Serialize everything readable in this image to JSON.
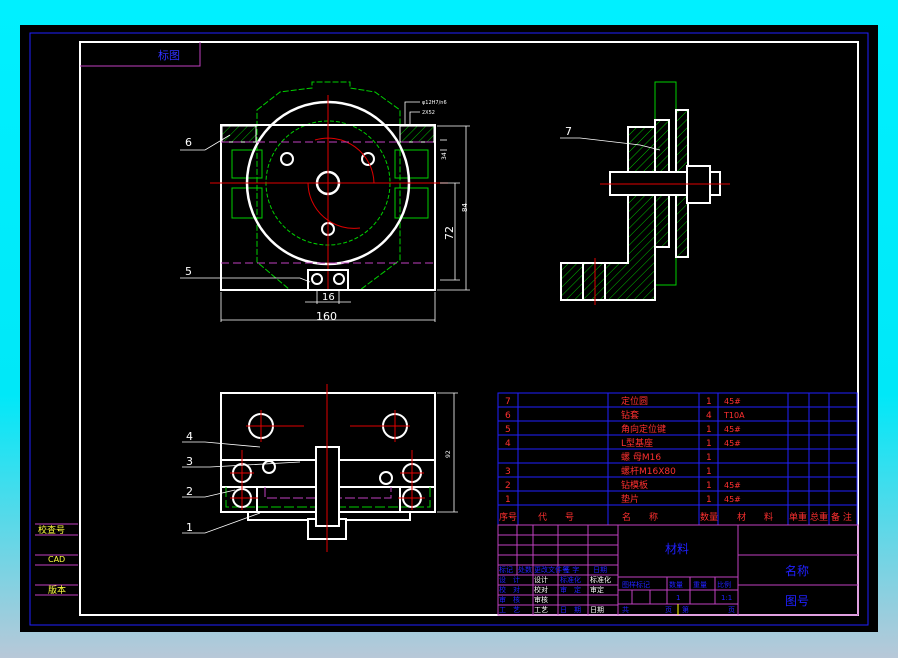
{
  "drawing": {
    "corner_label": "标图",
    "side_labels": [
      "校查号",
      "CAD",
      "版本"
    ],
    "dimensions": {
      "width_160": "160",
      "slot_16": "16",
      "height_72": "72",
      "height_84": "84",
      "small_34": "34",
      "fit": "φ12H7/n6",
      "fit2": "2X52",
      "front_height": "92"
    },
    "balloons": {
      "top": [
        "6",
        "5"
      ],
      "side": [
        "7"
      ],
      "front": [
        "4",
        "3",
        "2",
        "1"
      ]
    }
  },
  "parts_list": {
    "headers": [
      "序号",
      "代　　号",
      "名　　称",
      "数量",
      "材　　料",
      "单重",
      "总重",
      "备 注"
    ],
    "rows": [
      {
        "no": "7",
        "name": "定位圆",
        "qty": "1",
        "material": "45#"
      },
      {
        "no": "6",
        "name": "钻套",
        "qty": "4",
        "material": "T10A"
      },
      {
        "no": "5",
        "name": "角向定位键",
        "qty": "1",
        "material": "45#"
      },
      {
        "no": "4",
        "name": "L型基座",
        "qty": "1",
        "material": "45#"
      },
      {
        "no": "",
        "name": "螺 母M16",
        "qty": "1",
        "material": ""
      },
      {
        "no": "3",
        "name": "螺杆M16X80",
        "qty": "1",
        "material": ""
      },
      {
        "no": "2",
        "name": "钻模板",
        "qty": "1",
        "material": "45#"
      },
      {
        "no": "1",
        "name": "垫片",
        "qty": "1",
        "material": "45#"
      }
    ]
  },
  "title_block": {
    "material": "材料",
    "name": "名称",
    "drawing_no": "图号",
    "rev_header": [
      "标记",
      "处数",
      "更改文件号",
      "签 字",
      "日期"
    ],
    "sign_rows": [
      [
        "设　计",
        "设计",
        "标准化",
        "标准化"
      ],
      [
        "校　对",
        "校对",
        "审　定",
        "审定"
      ],
      [
        "审　核",
        "审核",
        "",
        ""
      ],
      [
        "工　艺",
        "工艺",
        "日　期",
        "日期"
      ]
    ],
    "stage_headers": [
      "图样标记",
      "数量",
      "重量",
      "比例"
    ],
    "quantity": "1",
    "scale": "1:1",
    "sheet": [
      "共",
      "页",
      "第",
      "页"
    ]
  }
}
